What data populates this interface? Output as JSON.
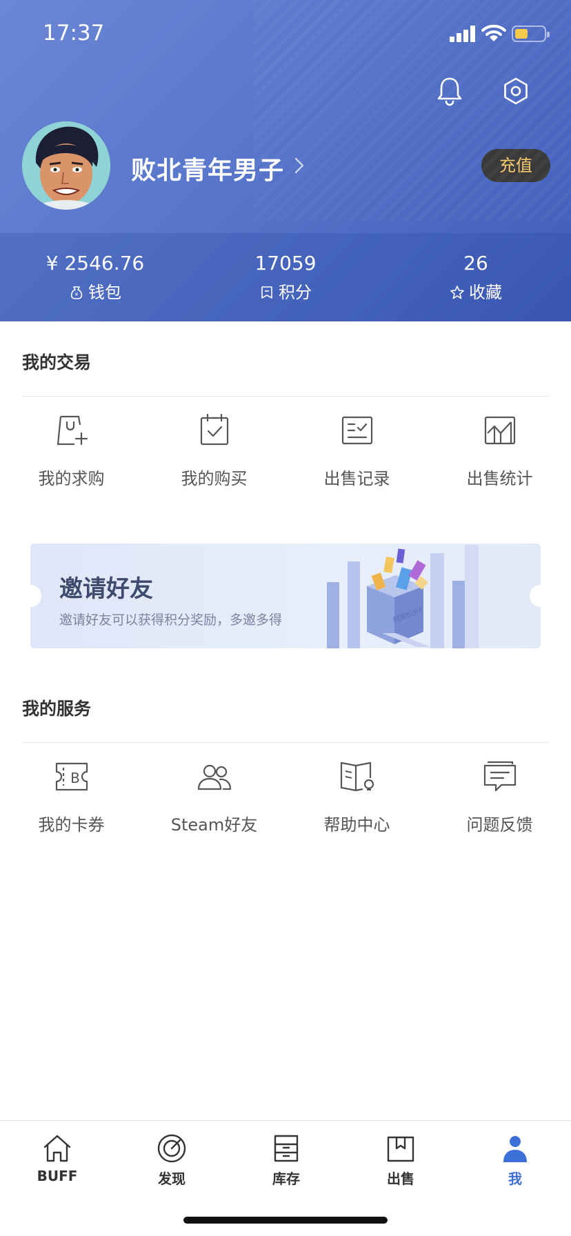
{
  "status_bar": {
    "time": "17:37"
  },
  "profile": {
    "username": "败北青年男子",
    "recharge_label": "充值"
  },
  "stats": [
    {
      "value": "¥ 2546.76",
      "label": "钱包",
      "icon": "wallet-icon"
    },
    {
      "value": "17059",
      "label": "积分",
      "icon": "points-icon"
    },
    {
      "value": "26",
      "label": "收藏",
      "icon": "star-icon"
    }
  ],
  "trade_section": {
    "title": "我的交易",
    "items": [
      {
        "label": "我的求购",
        "icon": "buy-request-icon"
      },
      {
        "label": "我的购买",
        "icon": "purchase-icon"
      },
      {
        "label": "出售记录",
        "icon": "sale-record-icon"
      },
      {
        "label": "出售统计",
        "icon": "sale-stats-icon"
      }
    ]
  },
  "invite_banner": {
    "title": "邀请好友",
    "subtitle": "邀请好友可以获得积分奖励，多邀多得",
    "art_text": "网易BUFF"
  },
  "service_section": {
    "title": "我的服务",
    "items": [
      {
        "label": "我的卡券",
        "icon": "coupon-icon"
      },
      {
        "label": "Steam好友",
        "icon": "friends-icon"
      },
      {
        "label": "帮助中心",
        "icon": "help-book-icon"
      },
      {
        "label": "问题反馈",
        "icon": "feedback-icon"
      }
    ]
  },
  "tabbar": {
    "active": "我",
    "items": [
      {
        "label": "BUFF",
        "icon": "home-icon"
      },
      {
        "label": "发现",
        "icon": "discover-icon"
      },
      {
        "label": "库存",
        "icon": "inventory-icon"
      },
      {
        "label": "出售",
        "icon": "sell-box-icon"
      },
      {
        "label": "我",
        "icon": "user-icon"
      }
    ]
  },
  "colors": {
    "header_gradient_start": "#6b86d4",
    "header_gradient_end": "#3f5cb8",
    "recharge_text": "#f5c86a",
    "active_tab": "#3d6fd9"
  }
}
